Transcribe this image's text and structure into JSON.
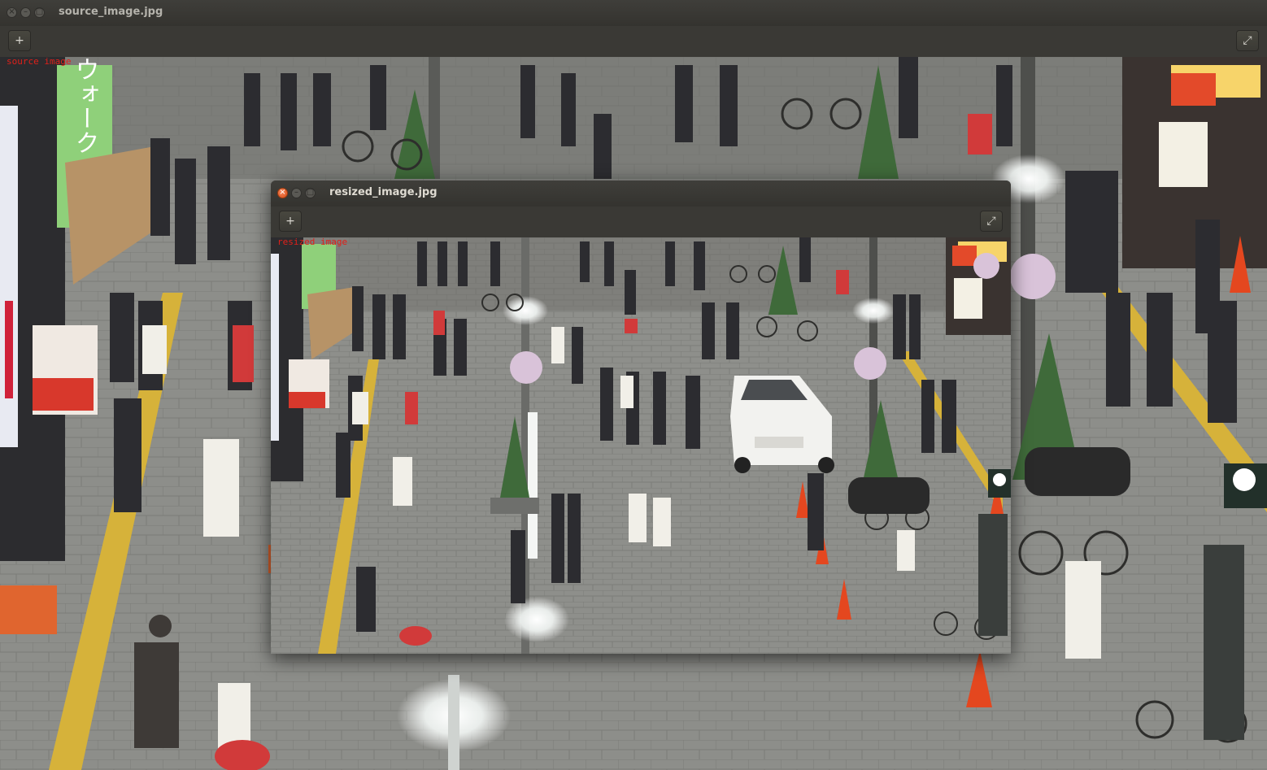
{
  "windows": {
    "source": {
      "title": "source_image.jpg",
      "overlay_label": "source image"
    },
    "resized": {
      "title": "resized_image.jpg",
      "overlay_label": "resized image"
    }
  },
  "titlebar_buttons": {
    "close": "×",
    "minimize": "–",
    "maximize": "□"
  },
  "toolbar_icons": {
    "add": "+",
    "expand": "⤢"
  },
  "scene": {
    "shop_sign_text": "ウォーク",
    "colors": {
      "pavement": "#8c8d89",
      "tactile_strip": "#d6b23a",
      "sign_green": "#8fd07a",
      "car": "#f2f2ef",
      "cone": "#e4471f",
      "shrub": "#3f6a3a"
    }
  }
}
